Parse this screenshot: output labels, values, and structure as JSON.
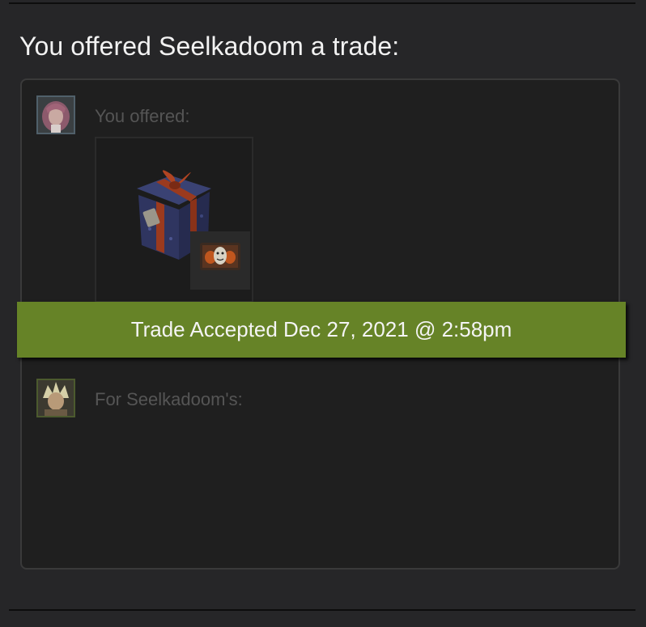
{
  "heading": "You offered Seelkadoom a trade:",
  "you_section": {
    "label": "You offered:",
    "avatar_icon": "anime-girl-avatar-icon",
    "items": [
      {
        "icon": "wrapped-gift-box-icon",
        "badge_icon": "masked-character-badge-icon"
      }
    ]
  },
  "them_section": {
    "label": "For Seelkadoom's:",
    "avatar_icon": "anime-boy-avatar-icon",
    "items": []
  },
  "status_banner": {
    "text": "Trade Accepted Dec 27, 2021 @ 2:58pm",
    "color": "#668327"
  }
}
